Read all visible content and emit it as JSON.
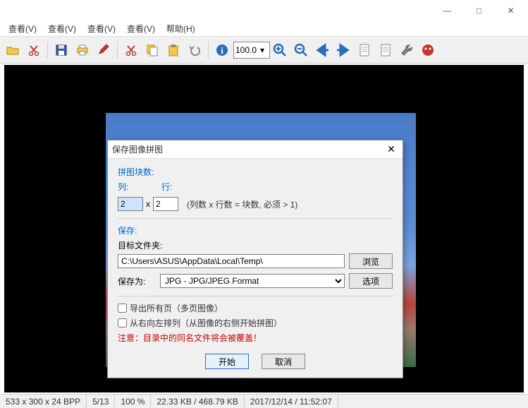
{
  "window": {
    "minimize": "—",
    "maximize": "□",
    "close": "✕"
  },
  "menubar": {
    "items": [
      "查看(V)",
      "查看(V)",
      "查看(V)",
      "查看(V)",
      "帮助(H)"
    ]
  },
  "toolbar": {
    "zoom_value": "100.0",
    "icons": {
      "open": "open-icon",
      "cut": "cut-icon",
      "save": "save-icon",
      "saveall": "saveall-icon",
      "edit": "edit-icon",
      "cut2": "cut-icon",
      "copy": "copy-icon",
      "paste": "paste-icon",
      "undo": "undo-icon",
      "info": "info-icon",
      "zoomin": "zoom-in-icon",
      "zoomout": "zoom-out-icon",
      "left": "arrow-left-icon",
      "right": "arrow-right-icon",
      "doc1": "document-icon",
      "doc2": "document-icon",
      "tools": "tools-icon",
      "mascot": "mascot-icon"
    }
  },
  "dialog": {
    "title": "保存图像拼图",
    "tiles_label": "拼图块数:",
    "col_label": "列:",
    "row_label": "行:",
    "col_value": "2",
    "row_value": "2",
    "x_label": "x",
    "formula_hint": "(列数 x 行数 = 块数, 必须 > 1)",
    "save_section": "保存:",
    "target_folder_label": "目标文件夹:",
    "target_folder_value": "C:\\Users\\ASUS\\AppData\\Local\\Temp\\",
    "browse_btn": "浏览",
    "save_as_label": "保存为:",
    "format_value": "JPG - JPG/JPEG Format",
    "options_btn": "选项",
    "export_all_label": "导出所有页（多页图像）",
    "rtl_label": "从右向左排列（从图像的右侧开始拼图）",
    "warning_text": "注意：目录中的同名文件将会被覆盖！",
    "start_btn": "开始",
    "cancel_btn": "取消"
  },
  "statusbar": {
    "dimensions": "533 x 300 x 24 BPP",
    "page": "5/13",
    "zoom": "100 %",
    "filesize": "22.33 KB / 468.79 KB",
    "datetime": "2017/12/14 / 11:52:07"
  }
}
